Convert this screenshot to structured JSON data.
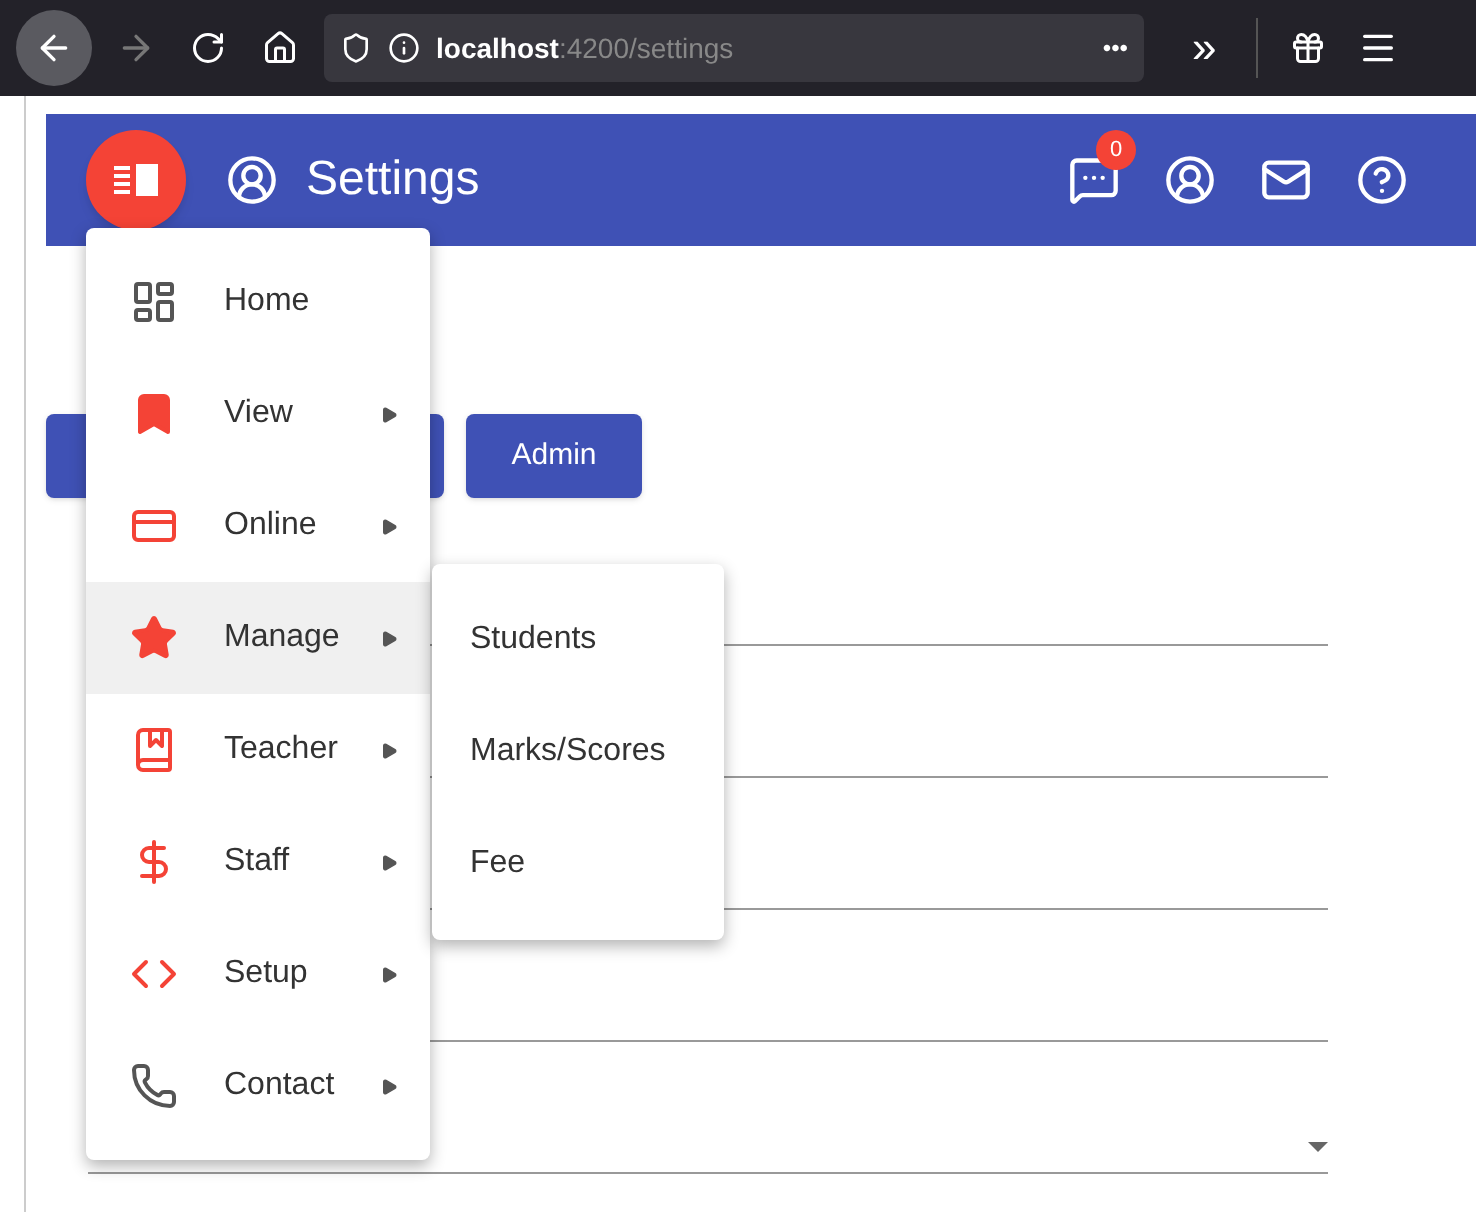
{
  "browser": {
    "url_host": "localhost",
    "url_rest": ":4200/settings",
    "back_enabled": true,
    "forward_enabled": false,
    "more": "•••",
    "overflow": "»"
  },
  "toolbar": {
    "title": "Settings",
    "notification_count": "0"
  },
  "buttons": [
    {
      "label": "Admin"
    }
  ],
  "menu": [
    {
      "label": "Home",
      "has_submenu": false,
      "selected": false
    },
    {
      "label": "View",
      "has_submenu": true,
      "selected": false
    },
    {
      "label": "Online",
      "has_submenu": true,
      "selected": false
    },
    {
      "label": "Manage",
      "has_submenu": true,
      "selected": true
    },
    {
      "label": "Teacher",
      "has_submenu": true,
      "selected": false
    },
    {
      "label": "Staff",
      "has_submenu": true,
      "selected": false
    },
    {
      "label": "Setup",
      "has_submenu": true,
      "selected": false
    },
    {
      "label": "Contact",
      "has_submenu": true,
      "selected": false
    }
  ],
  "submenu": [
    {
      "label": "Students"
    },
    {
      "label": "Marks/Scores"
    },
    {
      "label": "Fee"
    }
  ],
  "form_fields": [
    {
      "kind": "input"
    },
    {
      "kind": "input"
    },
    {
      "kind": "input"
    },
    {
      "kind": "input"
    },
    {
      "kind": "select"
    }
  ]
}
